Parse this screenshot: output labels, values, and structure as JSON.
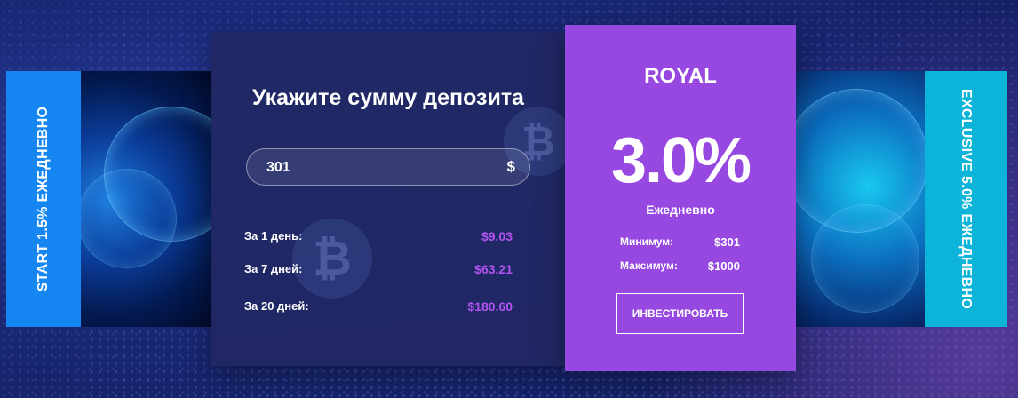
{
  "side_left": {
    "label": "START 1.5% ЕЖЕДНЕВНО",
    "accent": "#1687f2"
  },
  "side_right": {
    "label": "EXCLUSIVE 5.0% ЕЖЕДНЕВНО",
    "accent": "#0bb4d8"
  },
  "calculator": {
    "title": "Укажите сумму депозита",
    "amount_value": "301",
    "currency": "$",
    "rows": [
      {
        "label": "За 1 день:",
        "value": "$9.03"
      },
      {
        "label": "За 7 дней:",
        "value": "$63.21"
      },
      {
        "label": "За 20 дней:",
        "value": "$180.60"
      }
    ],
    "value_color": "#b054f0"
  },
  "plan": {
    "name": "ROYAL",
    "rate": "3.0%",
    "period": "Ежедневно",
    "min_label": "Минимум:",
    "min_value": "$301",
    "max_label": "Максимум:",
    "max_value": "$1000",
    "invest_label": "ИНВЕСТИРОВАТЬ",
    "accent": "#9648e0"
  }
}
